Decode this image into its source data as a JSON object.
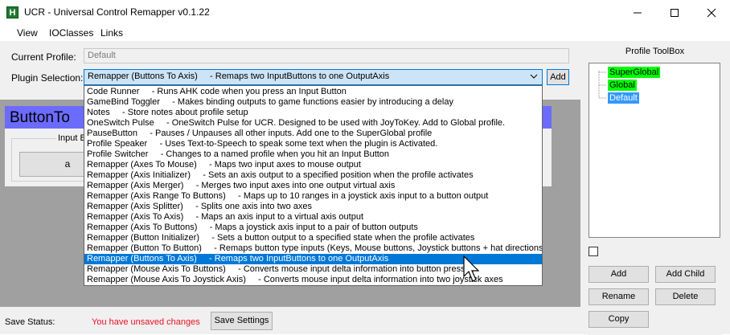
{
  "window": {
    "title": "UCR - Universal Control Remapper v0.1.22",
    "icon_letter": "H"
  },
  "menu": {
    "items": [
      "View",
      "IOClasses",
      "Links"
    ]
  },
  "profile": {
    "label": "Current Profile:",
    "value": "Default"
  },
  "plugin_selection": {
    "label": "Plugin Selection:",
    "selected": "Remapper (Buttons To Axis)     - Remaps two InputButtons to one OutputAxis",
    "add_label": "Add"
  },
  "plugin_panel": {
    "title": "ButtonTo",
    "group_label": "Input B",
    "button_label": "a"
  },
  "dropdown_options": [
    "Code Runner     - Runs AHK code when you press an Input Button",
    "GameBind Toggler     - Makes binding outputs to game functions easier by introducing a delay",
    "Notes     - Store notes about profile setup",
    "OneSwitch Pulse     - OneSwitch Pulse for UCR. Designed to be used with JoyToKey. Add to Global profile.",
    "PauseButton     - Pauses / Unpauses all other inputs. Add one to the SuperGlobal profile",
    "Profile Speaker     - Uses Text-to-Speech to speak some text when the plugin is Activated.",
    "Profile Switcher     - Changes to a named profile when you hit an Input Button",
    "Remapper (Axes To Mouse)     - Maps two input axes to mouse output",
    "Remapper (Axis Initializer)     - Sets an axis output to a specified position when the profile activates",
    "Remapper (Axis Merger)     - Merges two input axes into one output virtual axis",
    "Remapper (Axis Range To Buttons)     - Maps up to 10 ranges in a joystick axis input to a button output",
    "Remapper (Axis Splitter)     - Splits one axis into two axes",
    "Remapper (Axis To Axis)     - Maps an axis input to a virtual axis output",
    "Remapper (Axis To Buttons)     - Maps a joystick axis input to a pair of button outputs",
    "Remapper (Button Initializer)     - Sets a button output to a specified state when the profile activates",
    "Remapper (Button To Button)     - Remaps button type inputs (Keys, Mouse buttons, Joystick buttons + hat directions)",
    "Remapper (Buttons To Axis)     - Remaps two InputButtons to one OutputAxis",
    "Remapper (Mouse Axis To Buttons)     - Converts mouse input delta information into button presses",
    "Remapper (Mouse Axis To Joystick Axis)     - Converts mouse input delta information into two joystick axes"
  ],
  "dropdown_selected_index": 16,
  "status": {
    "label": "Save Status:",
    "value": "You have unsaved changes",
    "save_label": "Save Settings"
  },
  "toolbox": {
    "title": "Profile ToolBox",
    "tree": [
      {
        "label": "SuperGlobal",
        "bg": "#00ff00"
      },
      {
        "label": "Global",
        "bg": "#00ff00"
      },
      {
        "label": "Default",
        "bg": "#3399ff"
      }
    ],
    "buttons": {
      "add": "Add",
      "add_child": "Add Child",
      "rename": "Rename",
      "delete": "Delete",
      "copy": "Copy"
    }
  },
  "colors": {
    "accent": "#0078d7",
    "unsaved": "#e81123",
    "plugin_header": "#6b6bff"
  }
}
